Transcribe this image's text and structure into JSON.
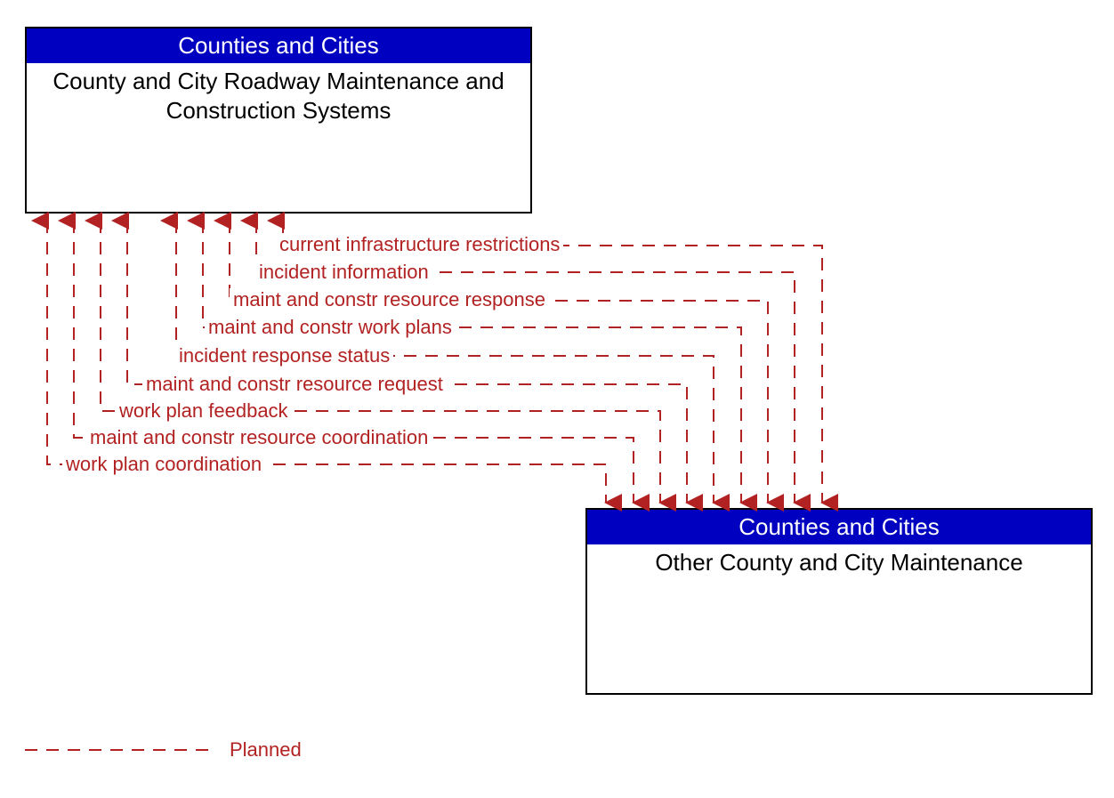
{
  "box1": {
    "header": "Counties and Cities",
    "body": "County and City Roadway Maintenance and Construction Systems"
  },
  "box2": {
    "header": "Counties and Cities",
    "body": "Other County and City Maintenance"
  },
  "flows": {
    "f1": "current infrastructure restrictions",
    "f2": "incident information",
    "f3": "maint and constr resource response",
    "f4": "maint and constr work plans",
    "f5": "incident response status",
    "f6": "maint and constr resource request",
    "f7": "work plan feedback",
    "f8": "maint and constr resource coordination",
    "f9": "work plan coordination"
  },
  "legend": {
    "planned": "Planned"
  },
  "colors": {
    "header_bg": "#0000c0",
    "flow_line": "#b22222"
  }
}
